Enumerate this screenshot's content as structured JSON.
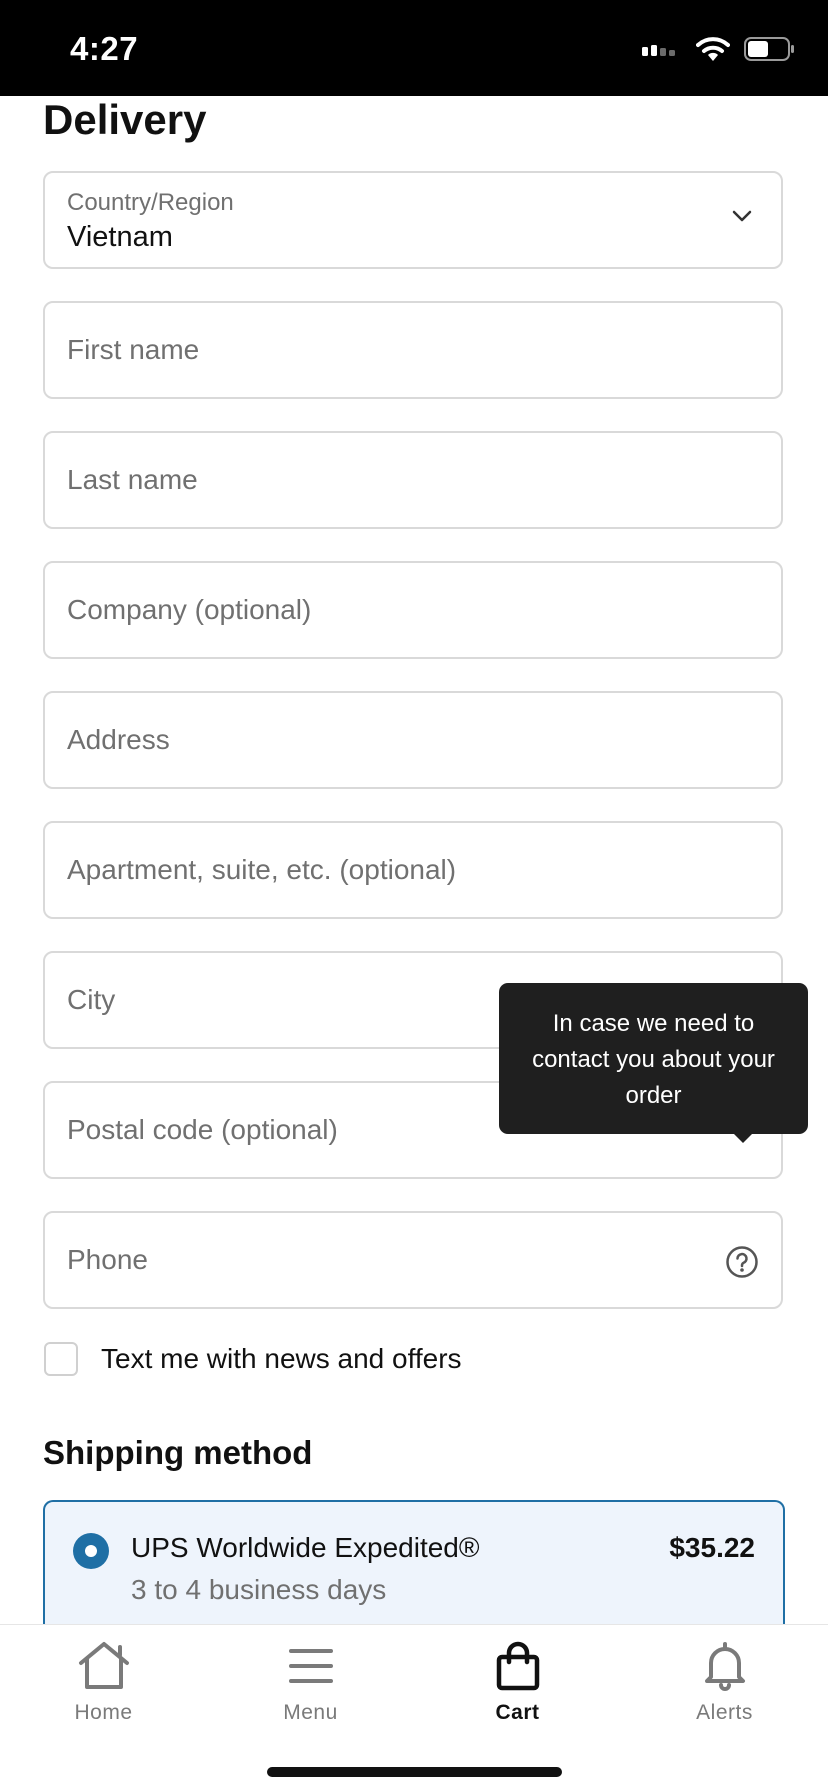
{
  "status_bar": {
    "time": "4:27"
  },
  "delivery": {
    "title": "Delivery",
    "country": {
      "label": "Country/Region",
      "value": "Vietnam"
    },
    "fields": {
      "first_name": "First name",
      "last_name": "Last name",
      "company": "Company (optional)",
      "address": "Address",
      "apartment": "Apartment, suite, etc. (optional)",
      "city": "City",
      "postal_code": "Postal code (optional)",
      "phone": "Phone"
    },
    "phone_tooltip": "In case we need to contact you about your order",
    "news_checkbox": {
      "label": "Text me with news and offers",
      "checked": false
    }
  },
  "shipping": {
    "title": "Shipping method",
    "option": {
      "name": "UPS Worldwide Expedited®",
      "days": "3 to 4 business days",
      "price": "$35.22",
      "selected": true
    }
  },
  "tab_bar": {
    "tabs": [
      {
        "label": "Home",
        "icon": "home-icon",
        "active": false
      },
      {
        "label": "Menu",
        "icon": "menu-icon",
        "active": false
      },
      {
        "label": "Cart",
        "icon": "shopping-bag-icon",
        "active": true
      },
      {
        "label": "Alerts",
        "icon": "bell-icon",
        "active": false
      }
    ]
  },
  "colors": {
    "accent": "#1f6fa5",
    "selected_bg": "#eef4fc",
    "tooltip_bg": "#1f1f1f",
    "placeholder": "#707070",
    "border": "#d9d9d9"
  }
}
